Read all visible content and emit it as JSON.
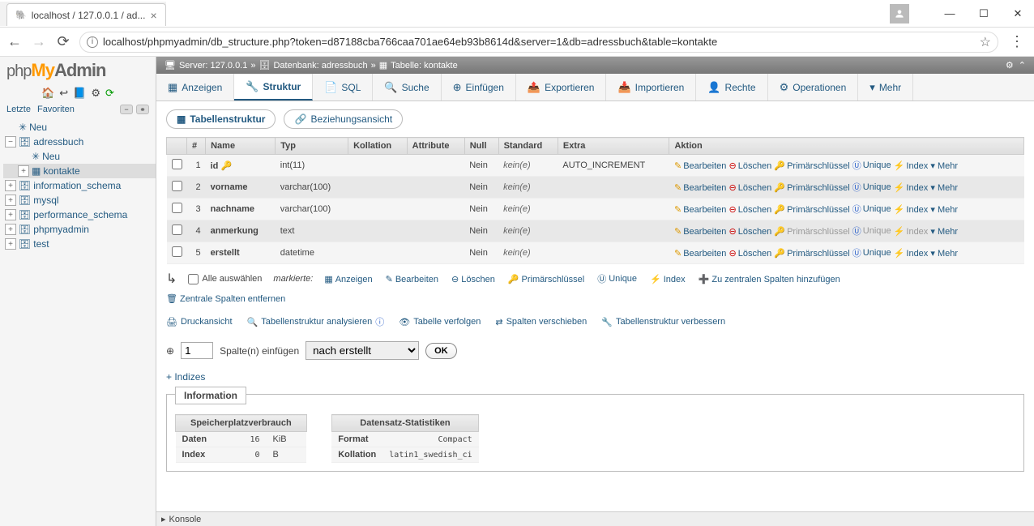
{
  "browser": {
    "tab_title": "localhost / 127.0.0.1 / ad...",
    "url": "localhost/phpmyadmin/db_structure.php?token=d87188cba766caa701ae64eb93b8614d&server=1&db=adressbuch&table=kontakte"
  },
  "breadcrumb": {
    "server_label": "Server: 127.0.0.1",
    "db_label": "Datenbank: adressbuch",
    "table_label": "Tabelle: kontakte"
  },
  "side": {
    "recent": "Letzte",
    "favorites": "Favoriten",
    "tree": [
      {
        "label": "Neu",
        "icon": "✳",
        "expand": "",
        "indent": 0
      },
      {
        "label": "adressbuch",
        "icon": "🗄",
        "expand": "−",
        "indent": 0
      },
      {
        "label": "Neu",
        "icon": "✳",
        "expand": "",
        "indent": 1
      },
      {
        "label": "kontakte",
        "icon": "▦",
        "expand": "+",
        "indent": 1,
        "selected": true
      },
      {
        "label": "information_schema",
        "icon": "🗄",
        "expand": "+",
        "indent": 0
      },
      {
        "label": "mysql",
        "icon": "🗄",
        "expand": "+",
        "indent": 0
      },
      {
        "label": "performance_schema",
        "icon": "🗄",
        "expand": "+",
        "indent": 0
      },
      {
        "label": "phpmyadmin",
        "icon": "🗄",
        "expand": "+",
        "indent": 0
      },
      {
        "label": "test",
        "icon": "🗄",
        "expand": "+",
        "indent": 0
      }
    ]
  },
  "tabs": {
    "main": [
      "Anzeigen",
      "Struktur",
      "SQL",
      "Suche",
      "Einfügen",
      "Exportieren",
      "Importieren",
      "Rechte",
      "Operationen",
      "Mehr"
    ],
    "main_icons": [
      "▦",
      "🔧",
      "📄",
      "🔍",
      "⊕",
      "📤",
      "📥",
      "👤",
      "⚙",
      "▾"
    ],
    "active": 1,
    "sub": [
      "Tabellenstruktur",
      "Beziehungsansicht"
    ],
    "sub_active": 0
  },
  "columns": {
    "headers": [
      "#",
      "Name",
      "Typ",
      "Kollation",
      "Attribute",
      "Null",
      "Standard",
      "Extra",
      "Aktion"
    ],
    "rows": [
      {
        "n": "1",
        "name": "id",
        "key": true,
        "type": "int(11)",
        "coll": "",
        "attr": "",
        "null": "Nein",
        "std": "kein(e)",
        "extra": "AUTO_INCREMENT",
        "pk_disabled": false
      },
      {
        "n": "2",
        "name": "vorname",
        "key": false,
        "type": "varchar(100)",
        "coll": "",
        "attr": "",
        "null": "Nein",
        "std": "kein(e)",
        "extra": "",
        "pk_disabled": false
      },
      {
        "n": "3",
        "name": "nachname",
        "key": false,
        "type": "varchar(100)",
        "coll": "",
        "attr": "",
        "null": "Nein",
        "std": "kein(e)",
        "extra": "",
        "pk_disabled": false
      },
      {
        "n": "4",
        "name": "anmerkung",
        "key": false,
        "type": "text",
        "coll": "",
        "attr": "",
        "null": "Nein",
        "std": "kein(e)",
        "extra": "",
        "pk_disabled": true
      },
      {
        "n": "5",
        "name": "erstellt",
        "key": false,
        "type": "datetime",
        "coll": "",
        "attr": "",
        "null": "Nein",
        "std": "kein(e)",
        "extra": "",
        "pk_disabled": false
      }
    ],
    "actions": {
      "edit": "Bearbeiten",
      "delete": "Löschen",
      "pk": "Primärschlüssel",
      "unique": "Unique",
      "index": "Index",
      "more": "Mehr"
    }
  },
  "bulk": {
    "select_all": "Alle auswählen",
    "marked": "markierte:",
    "links": [
      "Anzeigen",
      "Bearbeiten",
      "Löschen",
      "Primärschlüssel",
      "Unique",
      "Index",
      "Zu zentralen Spalten hinzufügen"
    ],
    "central_remove": "Zentrale Spalten entfernen"
  },
  "tools": [
    "Druckansicht",
    "Tabellenstruktur analysieren",
    "Tabelle verfolgen",
    "Spalten verschieben",
    "Tabellenstruktur verbessern"
  ],
  "insert": {
    "count": "1",
    "label": "Spalte(n) einfügen",
    "pos": "nach erstellt",
    "ok": "OK"
  },
  "indizes": "+ Indizes",
  "info": {
    "legend": "Information",
    "space_header": "Speicherplatzverbrauch",
    "space_rows": [
      [
        "Daten",
        "16",
        "KiB"
      ],
      [
        "Index",
        "0",
        "B"
      ]
    ],
    "stats_header": "Datensatz-Statistiken",
    "stats_rows": [
      [
        "Format",
        "Compact"
      ],
      [
        "Kollation",
        "latin1_swedish_ci"
      ]
    ]
  },
  "console": "Konsole"
}
